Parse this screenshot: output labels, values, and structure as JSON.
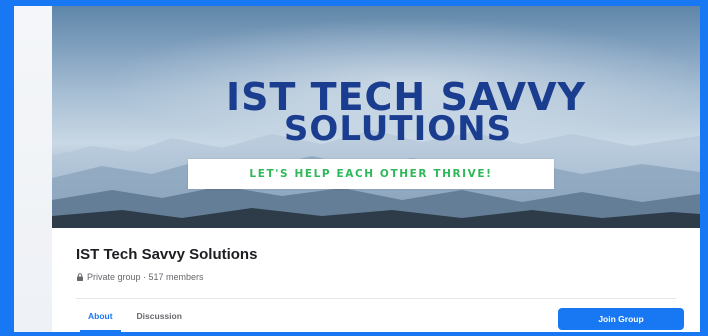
{
  "cover": {
    "title_line1": "IST TECH SAVVY",
    "title_line2": "SOLUTIONS",
    "slogan": "LET'S HELP EACH OTHER THRIVE!"
  },
  "group": {
    "name": "IST Tech Savvy Solutions",
    "meta": "Private group · 517 members",
    "lock_icon": "lock-icon"
  },
  "tabs": [
    {
      "label": "About",
      "active": true
    },
    {
      "label": "Discussion",
      "active": false
    }
  ],
  "actions": {
    "join_label": "Join Group"
  },
  "colors": {
    "accent": "#1877f2",
    "title": "#1a3d8f",
    "slogan": "#2fb85a",
    "text": "#1c1e21",
    "muted": "#65676b"
  }
}
